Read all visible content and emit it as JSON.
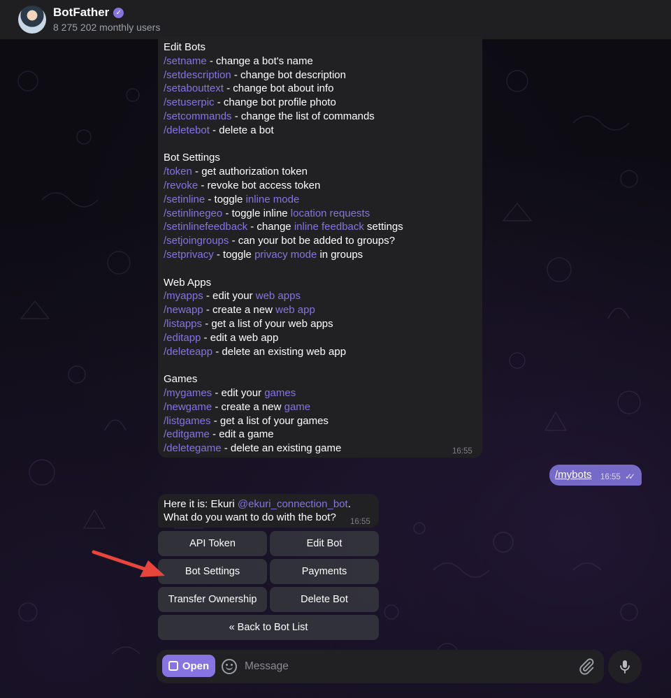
{
  "header": {
    "title": "BotFather",
    "subtitle": "8 275 202 monthly users"
  },
  "commands_message": {
    "sections": [
      {
        "heading": "Edit Bots",
        "items": [
          {
            "parts": [
              {
                "t": "/setname",
                "link": true
              },
              {
                "t": " - change a bot's name"
              }
            ]
          },
          {
            "parts": [
              {
                "t": "/setdescription",
                "link": true
              },
              {
                "t": " - change bot description"
              }
            ]
          },
          {
            "parts": [
              {
                "t": "/setabouttext",
                "link": true
              },
              {
                "t": " - change bot about info"
              }
            ]
          },
          {
            "parts": [
              {
                "t": "/setuserpic",
                "link": true
              },
              {
                "t": " - change bot profile photo"
              }
            ]
          },
          {
            "parts": [
              {
                "t": "/setcommands",
                "link": true
              },
              {
                "t": " - change the list of commands"
              }
            ]
          },
          {
            "parts": [
              {
                "t": "/deletebot",
                "link": true
              },
              {
                "t": " - delete a bot"
              }
            ]
          }
        ]
      },
      {
        "heading": "Bot Settings",
        "items": [
          {
            "parts": [
              {
                "t": "/token",
                "link": true
              },
              {
                "t": " - get authorization token"
              }
            ]
          },
          {
            "parts": [
              {
                "t": "/revoke",
                "link": true
              },
              {
                "t": " - revoke bot access token"
              }
            ]
          },
          {
            "parts": [
              {
                "t": "/setinline",
                "link": true
              },
              {
                "t": " - toggle "
              },
              {
                "t": "inline mode",
                "link": true
              }
            ]
          },
          {
            "parts": [
              {
                "t": "/setinlinegeo",
                "link": true
              },
              {
                "t": " - toggle inline "
              },
              {
                "t": "location requests",
                "link": true
              }
            ]
          },
          {
            "parts": [
              {
                "t": "/setinlinefeedback",
                "link": true
              },
              {
                "t": " - change "
              },
              {
                "t": "inline feedback",
                "link": true
              },
              {
                "t": " settings"
              }
            ]
          },
          {
            "parts": [
              {
                "t": "/setjoingroups",
                "link": true
              },
              {
                "t": " - can your bot be added to groups?"
              }
            ]
          },
          {
            "parts": [
              {
                "t": "/setprivacy",
                "link": true
              },
              {
                "t": " - toggle "
              },
              {
                "t": "privacy mode",
                "link": true
              },
              {
                "t": " in groups"
              }
            ]
          }
        ]
      },
      {
        "heading": "Web Apps",
        "items": [
          {
            "parts": [
              {
                "t": "/myapps",
                "link": true
              },
              {
                "t": " - edit your "
              },
              {
                "t": "web apps",
                "link": true
              }
            ]
          },
          {
            "parts": [
              {
                "t": "/newapp",
                "link": true
              },
              {
                "t": " - create a new "
              },
              {
                "t": "web app",
                "link": true
              }
            ]
          },
          {
            "parts": [
              {
                "t": "/listapps",
                "link": true
              },
              {
                "t": " - get a list of your web apps"
              }
            ]
          },
          {
            "parts": [
              {
                "t": "/editapp",
                "link": true
              },
              {
                "t": " - edit a web app"
              }
            ]
          },
          {
            "parts": [
              {
                "t": "/deleteapp",
                "link": true
              },
              {
                "t": " - delete an existing web app"
              }
            ]
          }
        ]
      },
      {
        "heading": "Games",
        "items": [
          {
            "parts": [
              {
                "t": "/mygames",
                "link": true
              },
              {
                "t": " - edit your "
              },
              {
                "t": "games",
                "link": true
              }
            ]
          },
          {
            "parts": [
              {
                "t": "/newgame",
                "link": true
              },
              {
                "t": " - create a new "
              },
              {
                "t": "game",
                "link": true
              }
            ]
          },
          {
            "parts": [
              {
                "t": "/listgames",
                "link": true
              },
              {
                "t": " - get a list of your games"
              }
            ]
          },
          {
            "parts": [
              {
                "t": "/editgame",
                "link": true
              },
              {
                "t": " - edit a game"
              }
            ]
          },
          {
            "parts": [
              {
                "t": "/deletegame",
                "link": true
              },
              {
                "t": " - delete an existing game"
              }
            ]
          }
        ]
      }
    ],
    "time": "16:55"
  },
  "outgoing_message": {
    "text": "/mybots",
    "time": "16:55"
  },
  "incoming_message": {
    "prefix": "Here it is: Ekuri ",
    "mention": "@ekuri_connection_bot",
    "suffix": ".",
    "line2": "What do you want to do with the bot?",
    "time": "16:55"
  },
  "keyboard": {
    "api_token": "API Token",
    "edit_bot": "Edit Bot",
    "bot_settings": "Bot Settings",
    "payments": "Payments",
    "transfer_ownership": "Transfer Ownership",
    "delete_bot": "Delete Bot",
    "back_to_list": "« Back to Bot List"
  },
  "composer": {
    "open_label": "Open",
    "placeholder": "Message"
  },
  "colors": {
    "accent": "#8774e1",
    "outgoing_bubble": "#766ac8",
    "annotation_arrow": "#e8453c"
  }
}
